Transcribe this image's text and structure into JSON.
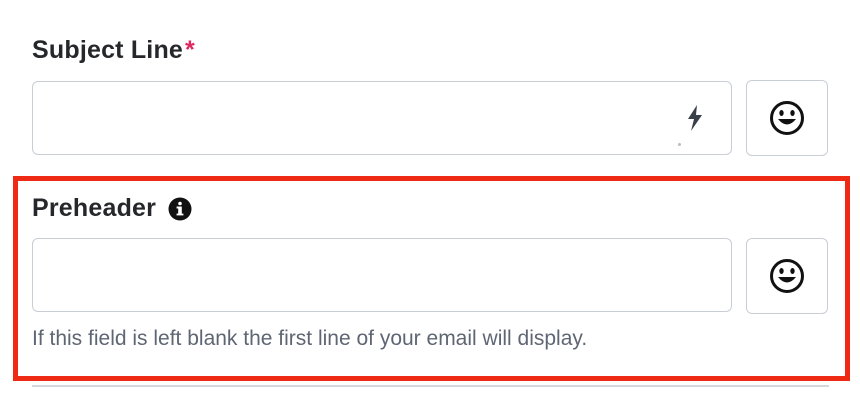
{
  "subject": {
    "label": "Subject Line",
    "required_mark": "*",
    "value": "",
    "emoji_button": "smiley-emoji-icon",
    "merge_icon": "lightning-bolt-icon"
  },
  "preheader": {
    "label": "Preheader",
    "info_icon": "info-icon",
    "value": "",
    "emoji_button": "smiley-emoji-icon",
    "helper_text": "If this field is left blank the first line of your email will display."
  },
  "colors": {
    "required": "#e0265e",
    "highlight": "#ee2a14",
    "border": "#c9ced6",
    "helper": "#5f6673"
  }
}
